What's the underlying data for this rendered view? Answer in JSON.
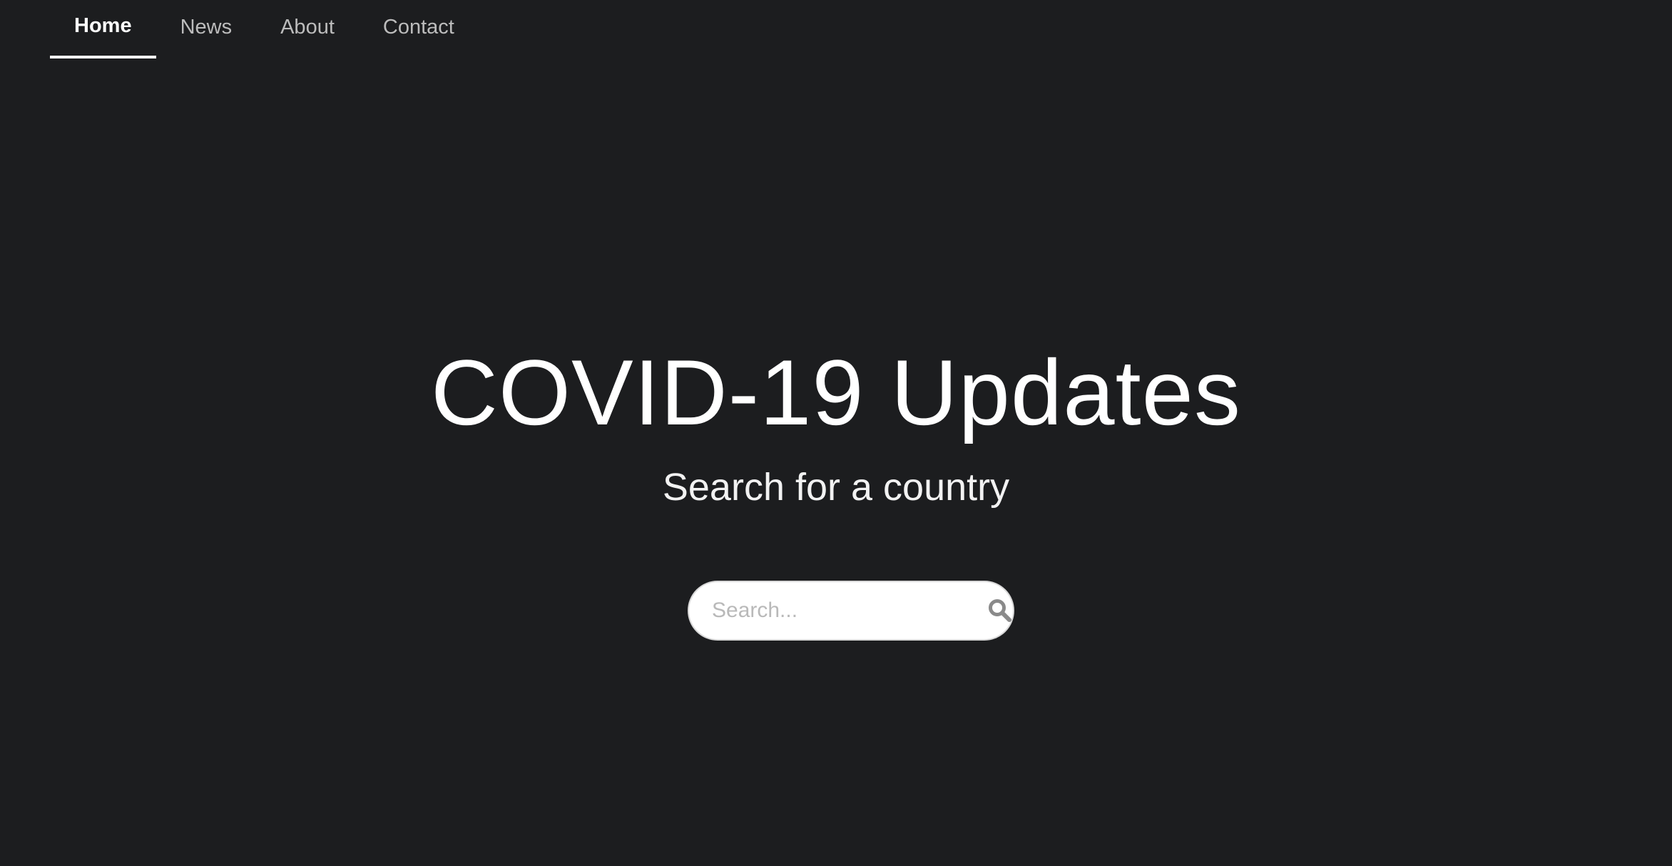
{
  "nav": {
    "items": [
      {
        "label": "Home",
        "active": true
      },
      {
        "label": "News",
        "active": false
      },
      {
        "label": "About",
        "active": false
      },
      {
        "label": "Contact",
        "active": false
      }
    ]
  },
  "hero": {
    "title": "COVID-19 Updates",
    "subtitle": "Search for a country"
  },
  "search": {
    "placeholder": "Search...",
    "value": "",
    "icon": "search-icon"
  },
  "colors": {
    "background": "#1c1d1f",
    "text": "#ffffff",
    "nav_inactive": "#bcbcbc",
    "search_bg": "#ffffff",
    "search_icon": "#8a8a8a"
  }
}
